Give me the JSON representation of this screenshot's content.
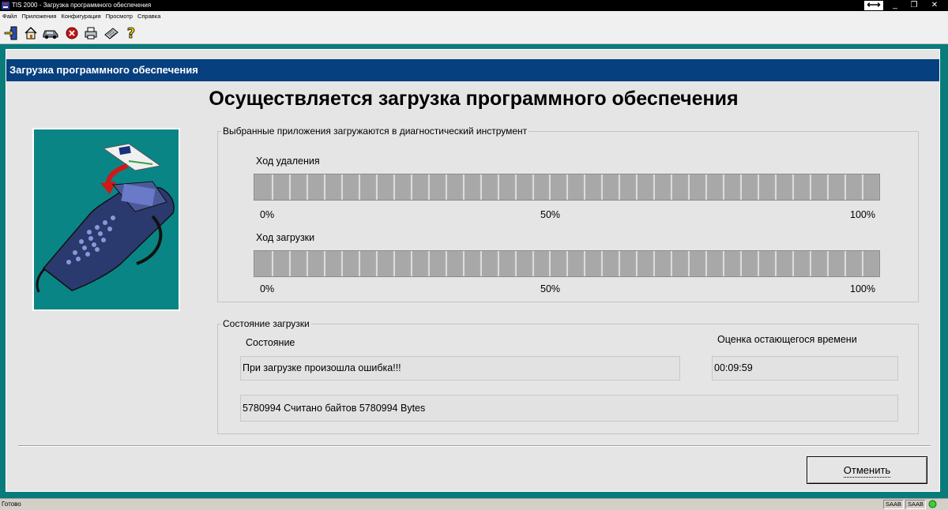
{
  "window": {
    "title": "TIS 2000 - Загрузка программного обеспечения",
    "minimize": "_",
    "restore": "❐",
    "close": "✕"
  },
  "menu": [
    "Файл",
    "Приложения",
    "Конфигурация",
    "Просмотр",
    "Справка"
  ],
  "toolbar": {
    "icons": [
      "exit-icon",
      "home-icon",
      "vehicle-icon",
      "stop-icon",
      "print-icon",
      "keyboard-icon",
      "help-icon"
    ]
  },
  "panel": {
    "header": "Загрузка программного обеспечения",
    "heading": "Осуществляется загрузка программного обеспечения"
  },
  "apps_group": {
    "title": "Выбранные приложения загружаются в диагностический инструмент",
    "delete_label": "Ход удаления",
    "download_label": "Ход загрузки",
    "ticks": [
      "0%",
      "50%",
      "100%"
    ],
    "delete_progress": 0,
    "download_progress": 0
  },
  "status_group": {
    "title": "Состояние загрузки",
    "state_label": "Состояние",
    "time_label": "Оценка остающегося времени",
    "state_value": "При загрузке произошла ошибка!!!",
    "time_value": "00:09:59",
    "bytes_value": "5780994 Считано байтов 5780994 Bytes"
  },
  "buttons": {
    "cancel": "Отменить"
  },
  "statusbar": {
    "text": "Готово",
    "cell1": "SAAB",
    "cell2": "SAAB"
  },
  "colors": {
    "frame": "#0a7b7b",
    "header": "#06407f",
    "panel": "#e5e5e5"
  }
}
